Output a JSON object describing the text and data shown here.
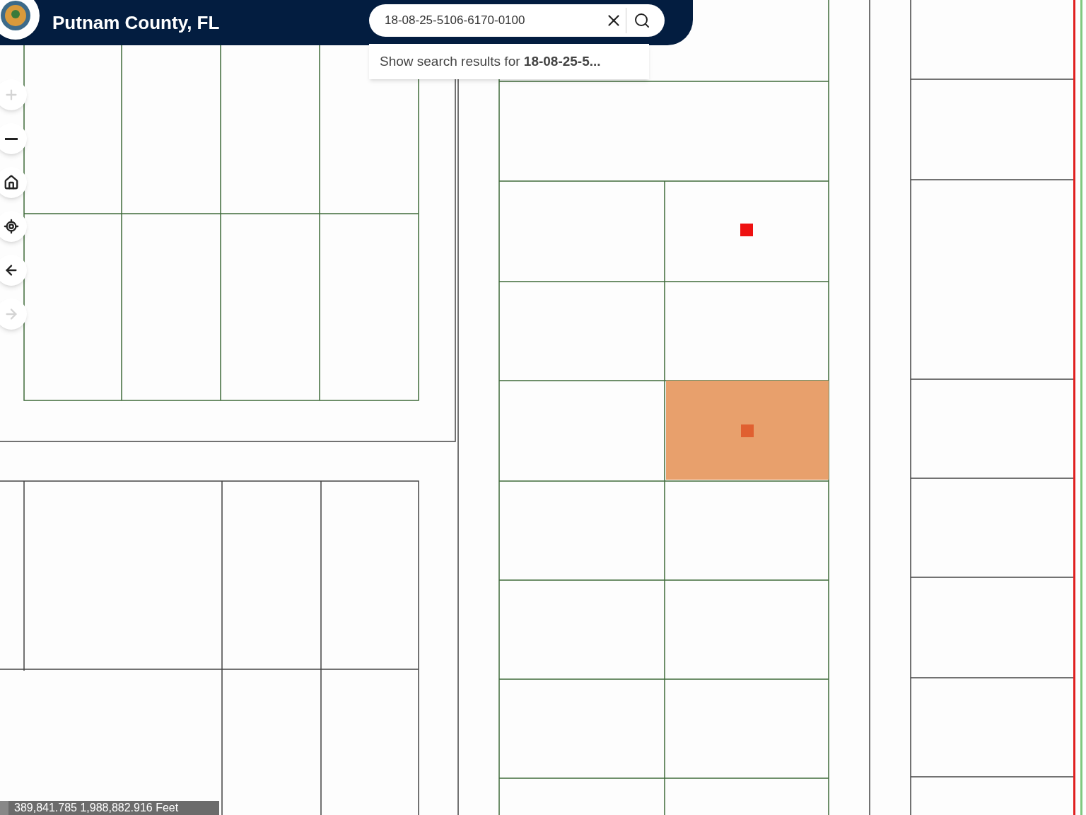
{
  "header": {
    "title": "Putnam County, FL"
  },
  "search": {
    "value": "18-08-25-5106-6170-0100"
  },
  "suggestion": {
    "text": "Show search results for **18-08-25-5...**"
  },
  "controls": [
    {
      "kind": "zoom-in",
      "disabled": true
    },
    {
      "kind": "zoom-out",
      "disabled": false
    },
    {
      "kind": "home",
      "disabled": false
    },
    {
      "kind": "locate",
      "disabled": false
    },
    {
      "kind": "back",
      "disabled": false
    },
    {
      "kind": "forward",
      "disabled": true
    }
  ],
  "status_bar": {
    "coordinates": "389,841.785 1,988,882.916 Feet"
  }
}
